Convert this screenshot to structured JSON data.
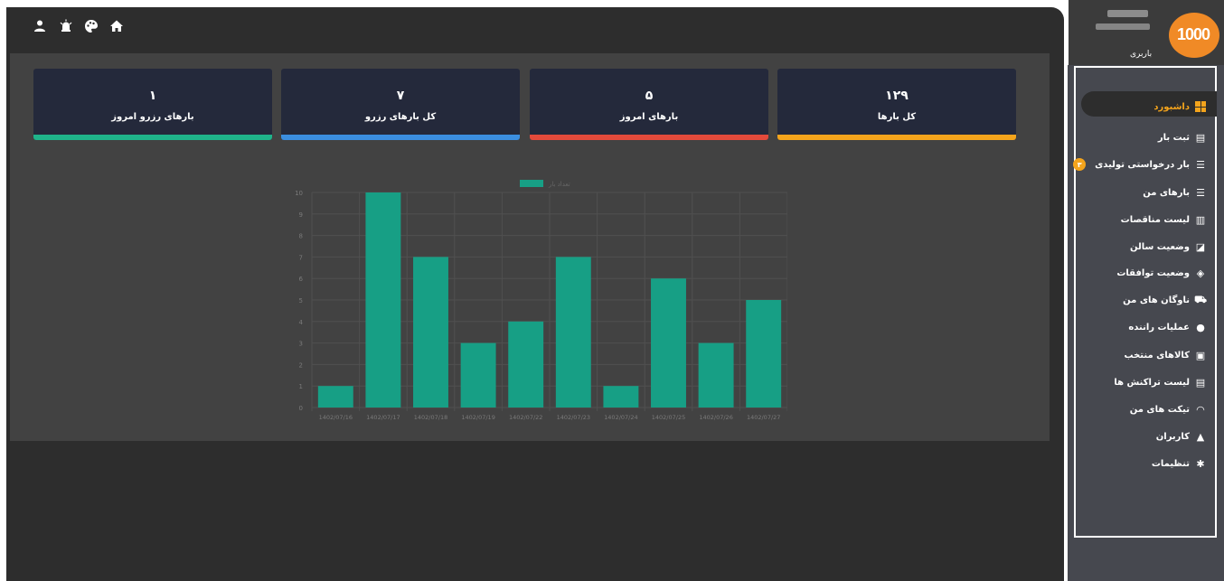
{
  "topbar": {
    "icons": [
      "user-icon",
      "alarm-icon",
      "palette-icon",
      "home-icon"
    ]
  },
  "cards": [
    {
      "value": "۱۲۹",
      "label": "کل بارها",
      "color": "#f4a41c"
    },
    {
      "value": "۵",
      "label": "بارهای امروز",
      "color": "#e34a3b"
    },
    {
      "value": "۷",
      "label": "کل بارهای رزرو",
      "color": "#3b8ee0"
    },
    {
      "value": "۱",
      "label": "بارهای رزرو امروز",
      "color": "#1fb38a"
    }
  ],
  "chart_data": {
    "type": "bar",
    "categories": [
      "1402/07/16",
      "1402/07/17",
      "1402/07/18",
      "1402/07/19",
      "1402/07/22",
      "1402/07/23",
      "1402/07/24",
      "1402/07/25",
      "1402/07/26",
      "1402/07/27"
    ],
    "series": [
      {
        "name": "تعداد بار",
        "values": [
          1,
          10,
          7,
          3,
          4,
          7,
          1,
          6,
          3,
          5
        ]
      }
    ],
    "ylim": [
      0,
      10
    ],
    "yticks": [
      0,
      1,
      2,
      3,
      4,
      5,
      6,
      7,
      8,
      9,
      10
    ],
    "grid": true,
    "legend": "top-center",
    "bar_color": "#179f85"
  },
  "user": {
    "role": "باربری",
    "logo_text": "1000"
  },
  "sidebar": {
    "items": [
      {
        "label": "داشبورد",
        "icon": "dashboard-icon",
        "active": true
      },
      {
        "label": "ثبت بار",
        "icon": "add-post-icon"
      },
      {
        "label": "بار درخواستی تولیدی",
        "icon": "list-icon",
        "badge": "۳"
      },
      {
        "label": "بارهای من",
        "icon": "list-icon"
      },
      {
        "label": "لیست مناقصات",
        "icon": "clipboard-icon"
      },
      {
        "label": "وضعیت سالن",
        "icon": "clipboard-time-icon"
      },
      {
        "label": "وضعیت توافقات",
        "icon": "handshake-icon"
      },
      {
        "label": "ناوگان های من",
        "icon": "truck-icon"
      },
      {
        "label": "عملیات راننده",
        "icon": "account-circle-icon"
      },
      {
        "label": "کالاهای منتخب",
        "icon": "file-check-icon"
      },
      {
        "label": "لیست تراکنش ها",
        "icon": "receipt-icon"
      },
      {
        "label": "تیکت های من",
        "icon": "support-icon"
      },
      {
        "label": "کاربران",
        "icon": "user-icon"
      },
      {
        "label": "تنظیمات",
        "icon": "gear-icon"
      }
    ]
  }
}
